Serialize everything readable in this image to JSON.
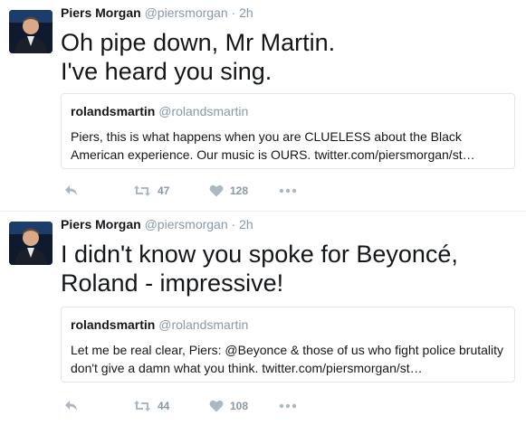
{
  "tweets": [
    {
      "author_name": "Piers Morgan",
      "author_handle": "@piersmorgan",
      "separator": "·",
      "time": "2h",
      "text": "Oh pipe down, Mr Martin.\nI've heard you sing.",
      "quote": {
        "name": "rolandsmartin",
        "handle": "@rolandsmartin",
        "text": "Piers, this is what happens when you are CLUELESS about the Black American experience. Our music is OURS. twitter.com/piersmorgan/st…"
      },
      "retweets": "47",
      "likes": "128"
    },
    {
      "author_name": "Piers Morgan",
      "author_handle": "@piersmorgan",
      "separator": "·",
      "time": "2h",
      "text": "I didn't know you spoke for Beyoncé,\nRoland - impressive!",
      "quote": {
        "name": "rolandsmartin",
        "handle": "@rolandsmartin",
        "text": "Let me be real clear, Piers: @Beyonce & those of us who fight police brutality don't give a damn what you think. twitter.com/piersmorgan/st…"
      },
      "retweets": "44",
      "likes": "108"
    }
  ],
  "icons": {
    "reply": "reply-icon",
    "retweet": "retweet-icon",
    "like": "heart-icon",
    "more": "more-dots-icon"
  },
  "colors": {
    "icon_gray": "#aab8c2",
    "secondary_text": "#8899a6",
    "border": "#e1e8ed"
  }
}
